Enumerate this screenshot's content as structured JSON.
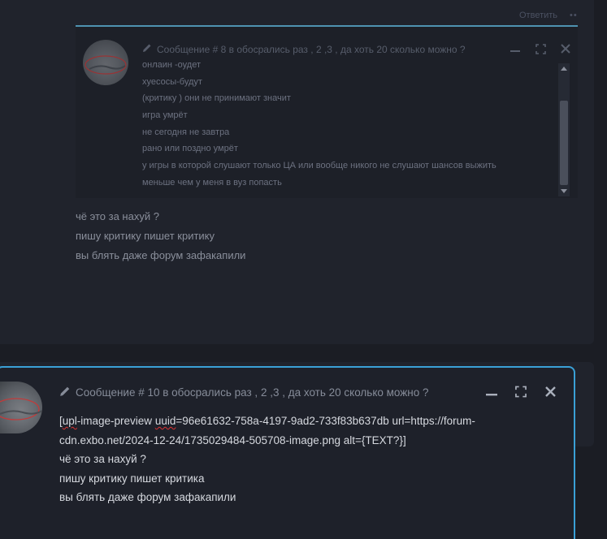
{
  "top_post": {
    "reply_label": "Ответить",
    "more_label": "••"
  },
  "quote": {
    "header": "Сообщение # 8 в обосрались раз , 2 ,3 , да хоть 20 сколько можно ?",
    "lines": [
      "онлаин -оудет",
      "хуесосы-будут",
      "(критику ) они не принимают значит",
      "игра умрёт",
      "не сегодня не завтра",
      "рано или поздно умрёт",
      "у игры в которой слушают только ЦА или вообще никого не слушают шансов выжить",
      "меньше чем у меня в вуз попасть"
    ]
  },
  "post_body": {
    "lines": [
      "чё это за нахуй ?",
      "пишу критику пишет критику",
      "вы блять даже форум зафакапили"
    ]
  },
  "editor": {
    "header": "Сообщение # 10 в обосрались раз , 2 ,3 , да хоть 20 сколько можно ?",
    "line1_a": "[",
    "line1_b": "upl",
    "line1_c": "-image-preview ",
    "line1_d": "uuid",
    "line1_e": "=96e61632-758a-4197-9ad2-733f83b637db url=https://forum-cdn.exbo.net/2024-12-24/1735029484-505708-image.png alt={TEXT?}]",
    "lines": [
      "чё это за нахуй ?",
      "пишу критику пишет критика",
      "вы блять даже форум зафакапили"
    ]
  },
  "icons": {
    "pencil": "pencil-icon",
    "minimize": "minimize-icon",
    "fullscreen": "fullscreen-icon",
    "close": "close-icon"
  },
  "colors": {
    "accent": "#3aa0d6",
    "quote_border": "#4f93b1",
    "background": "#1b1d24",
    "card": "#20232c"
  }
}
